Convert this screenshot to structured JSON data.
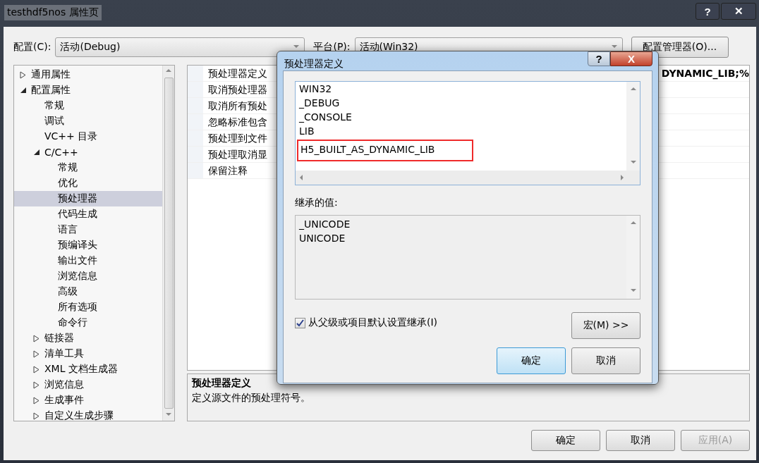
{
  "window": {
    "title": "testhdf5nos 属性页",
    "help": "?",
    "close": "✕"
  },
  "config": {
    "label": "配置(C):",
    "value": "活动(Debug)"
  },
  "platform": {
    "label": "平台(P):",
    "value": "活动(Win32)"
  },
  "config_manager": "配置管理器(O)...",
  "tree": [
    {
      "label": "通用属性",
      "expanded": false,
      "selected": false
    },
    {
      "label": "配置属性",
      "expanded": true,
      "selected": false,
      "children": [
        {
          "label": "常规",
          "selected": false
        },
        {
          "label": "调试",
          "selected": false
        },
        {
          "label": "VC++ 目录",
          "selected": false
        },
        {
          "label": "C/C++",
          "expanded": true,
          "selected": false,
          "children": [
            {
              "label": "常规",
              "selected": false
            },
            {
              "label": "优化",
              "selected": false
            },
            {
              "label": "预处理器",
              "selected": true
            },
            {
              "label": "代码生成",
              "selected": false
            },
            {
              "label": "语言",
              "selected": false
            },
            {
              "label": "预编译头",
              "selected": false
            },
            {
              "label": "输出文件",
              "selected": false
            },
            {
              "label": "浏览信息",
              "selected": false
            },
            {
              "label": "高级",
              "selected": false
            },
            {
              "label": "所有选项",
              "selected": false
            },
            {
              "label": "命令行",
              "selected": false
            }
          ]
        },
        {
          "label": "链接器",
          "expanded": false,
          "selected": false
        },
        {
          "label": "清单工具",
          "expanded": false,
          "selected": false
        },
        {
          "label": "XML 文档生成器",
          "expanded": false,
          "selected": false
        },
        {
          "label": "浏览信息",
          "expanded": false,
          "selected": false
        },
        {
          "label": "生成事件",
          "expanded": false,
          "selected": false
        },
        {
          "label": "自定义生成步骤",
          "expanded": false,
          "selected": false
        }
      ]
    }
  ],
  "properties": [
    {
      "name": "预处理器定义",
      "value": "DYNAMIC_LIB;%"
    },
    {
      "name": "取消预处理器"
    },
    {
      "name": "取消所有预处"
    },
    {
      "name": "忽略标准包含"
    },
    {
      "name": "预处理到文件"
    },
    {
      "name": "预处理取消显"
    },
    {
      "name": "保留注释"
    }
  ],
  "description": {
    "title": "预处理器定义",
    "text": "定义源文件的预处理符号。"
  },
  "buttons": [
    {
      "label": "确定",
      "disabled": false
    },
    {
      "label": "取消",
      "disabled": false
    },
    {
      "label": "应用(A)",
      "disabled": true
    }
  ],
  "dialog": {
    "title": "预处理器定义",
    "help": "?",
    "close": "X",
    "definitions": [
      {
        "text": "WIN32",
        "highlighted": false
      },
      {
        "text": "_DEBUG",
        "highlighted": false
      },
      {
        "text": "_CONSOLE",
        "highlighted": false
      },
      {
        "text": "LIB",
        "highlighted": false
      },
      {
        "text": "H5_BUILT_AS_DYNAMIC_LIB",
        "highlighted": true
      }
    ],
    "inherited_label": "继承的值:",
    "inherited": [
      "_UNICODE",
      "UNICODE"
    ],
    "inherit_checkbox": {
      "label": "从父级或项目默认设置继承(I)",
      "checked": true
    },
    "macro_button": "宏(M) >>",
    "ok": "确定",
    "cancel": "取消"
  }
}
